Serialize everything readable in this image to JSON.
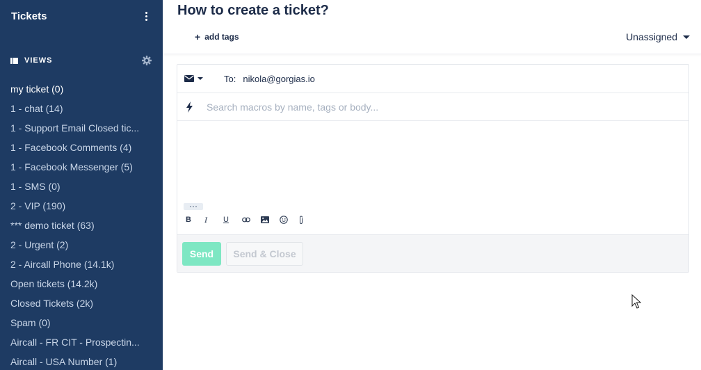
{
  "sidebar": {
    "title": "Tickets",
    "views_label": "VIEWS",
    "items": [
      {
        "label": "my ticket (0)",
        "active": true
      },
      {
        "label": "1 - chat (14)"
      },
      {
        "label": "1 - Support Email Closed tic..."
      },
      {
        "label": "1 - Facebook Comments (4)"
      },
      {
        "label": "1 - Facebook Messenger (5)"
      },
      {
        "label": "1 - SMS (0)"
      },
      {
        "label": "2 - VIP (190)"
      },
      {
        "label": "*** demo ticket (63)"
      },
      {
        "label": "2 - Urgent (2)"
      },
      {
        "label": "2 - Aircall Phone (14.1k)"
      },
      {
        "label": "Open tickets (14.2k)"
      },
      {
        "label": "Closed Tickets (2k)"
      },
      {
        "label": "Spam (0)"
      },
      {
        "label": "Aircall - FR CIT - Prospectin..."
      },
      {
        "label": "Aircall - USA Number (1)"
      }
    ]
  },
  "header": {
    "title": "How to create a ticket?",
    "add_tags": "add tags",
    "assignee": "Unassigned"
  },
  "composer": {
    "to_label": "To:",
    "to_value": "nikola@gorgias.io",
    "macro_placeholder": "Search macros by name, tags or body...",
    "send_label": "Send",
    "send_close_label": "Send & Close"
  },
  "colors": {
    "sidebar_bg": "#1e3b63",
    "send_button": "#7ee7c3",
    "text_dark": "#1c2b48"
  },
  "icons": {
    "sidebar_menu": "kebab-icon",
    "views": "views-list-icon",
    "views_settings": "gear-icon",
    "add_tags": "plus-icon",
    "assignee_dropdown": "chevron-down-icon",
    "channel": "envelope-icon",
    "macros": "lightning-bolt-icon",
    "toolbar": [
      "bold-icon",
      "italic-icon",
      "underline-icon",
      "link-icon",
      "image-icon",
      "emoji-icon",
      "attachment-icon"
    ]
  }
}
